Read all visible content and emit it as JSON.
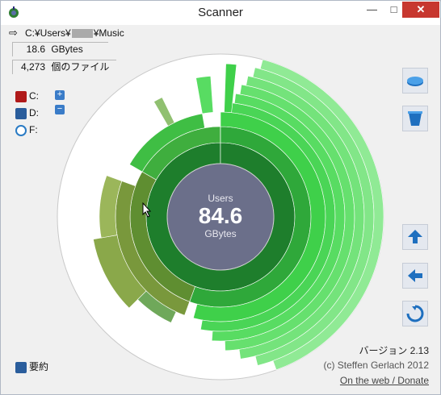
{
  "window": {
    "title": "Scanner",
    "controls": {
      "minimize": "—",
      "maximize": "□",
      "close": "✕"
    }
  },
  "path": {
    "prefix": "C:¥Users¥",
    "suffix": "¥Music"
  },
  "stats": {
    "size_value": "18.6",
    "size_unit": "GBytes",
    "file_count": "4,273",
    "file_label": "個のファイル"
  },
  "drives": [
    {
      "label": "C:",
      "icon": "drive-c-icon",
      "color": "#b01a1a"
    },
    {
      "label": "D:",
      "icon": "drive-d-icon",
      "color": "#2a5d9c"
    },
    {
      "label": "F:",
      "icon": "cd-drive-icon",
      "color": "#2a7bc4"
    }
  ],
  "center": {
    "name": "Users",
    "value": "84.6",
    "unit": "GBytes"
  },
  "toolbar": {
    "icons": [
      "open-drive-icon",
      "recycle-bin-icon",
      "go-up-icon",
      "back-icon",
      "refresh-icon"
    ]
  },
  "footer": {
    "version": "バージョン 2.13",
    "copyright": "(c) Steffen Gerlach 2012",
    "link": "On the web / Donate",
    "summary": "要約"
  },
  "colors": {
    "center": "#6b6f8a",
    "ring1": "#1e7e2c",
    "bright_green": "#3fd04a",
    "light_green": "#7ee07a",
    "olive": "#7a9a3a"
  }
}
